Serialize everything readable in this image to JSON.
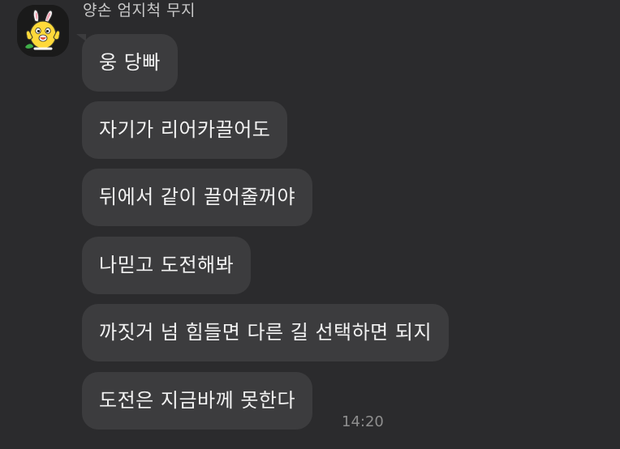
{
  "sender": {
    "name": "양손 엄지척 무지",
    "avatar_icon": "muzi-rabbit-thumbs-up-icon"
  },
  "messages": [
    {
      "text": "웅 당빠"
    },
    {
      "text": "자기가 리어카끌어도"
    },
    {
      "text": "뒤에서 같이 끌어줄꺼야"
    },
    {
      "text": "나믿고 도전해봐"
    },
    {
      "text": "까짓거 넘 힘들면 다른 길 선택하면 되지"
    },
    {
      "text": "도전은 지금바께 못한다"
    }
  ],
  "last_message_time": "14:20",
  "colors": {
    "background": "#2b2b2d",
    "bubble": "#3c3c3e",
    "text": "#f2f2f2",
    "timestamp": "#8e8e8e"
  }
}
